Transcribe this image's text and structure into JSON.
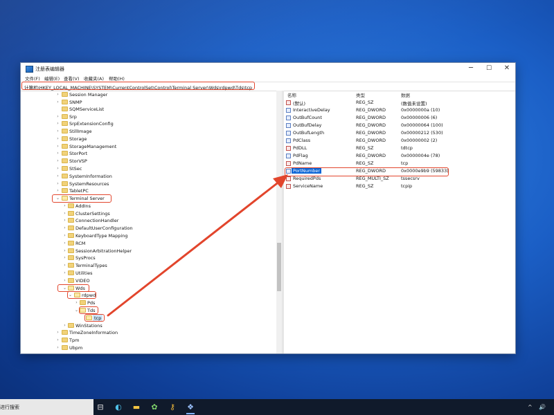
{
  "window": {
    "title": "注册表编辑器",
    "minimize_glyph": "─",
    "maximize_glyph": "☐",
    "close_glyph": "✕"
  },
  "menu": [
    "文件(F)",
    "编辑(E)",
    "查看(V)",
    "收藏夹(A)",
    "帮助(H)"
  ],
  "address": "计算机\\HKEY_LOCAL_MACHINE\\SYSTEM\\CurrentControlSet\\Control\\Terminal Server\\Wds\\rdpwd\\Tds\\tcp",
  "tree": [
    {
      "label": "Session Manager",
      "expand": "›"
    },
    {
      "label": "SNMP",
      "expand": "›"
    },
    {
      "label": "SQMServiceList",
      "expand": ""
    },
    {
      "label": "Srp",
      "expand": "›"
    },
    {
      "label": "SrpExtensionConfig",
      "expand": "›"
    },
    {
      "label": "StillImage",
      "expand": "›"
    },
    {
      "label": "Storage",
      "expand": "›"
    },
    {
      "label": "StorageManagement",
      "expand": "›"
    },
    {
      "label": "StorPort",
      "expand": "›"
    },
    {
      "label": "StorVSP",
      "expand": "›"
    },
    {
      "label": "StSec",
      "expand": "›"
    },
    {
      "label": "SystemInformation",
      "expand": "›"
    },
    {
      "label": "SystemResources",
      "expand": "›"
    },
    {
      "label": "TabletPC",
      "expand": "›"
    },
    {
      "label": "Terminal Server",
      "expand": "⌄"
    },
    {
      "label": "AddIns",
      "expand": "›"
    },
    {
      "label": "ClusterSettings",
      "expand": "›"
    },
    {
      "label": "ConnectionHandler",
      "expand": "›"
    },
    {
      "label": "DefaultUserConfiguration",
      "expand": "›"
    },
    {
      "label": "KeyboardType Mapping",
      "expand": "›"
    },
    {
      "label": "RCM",
      "expand": "›"
    },
    {
      "label": "SessionArbitrationHelper",
      "expand": "›"
    },
    {
      "label": "SysProcs",
      "expand": "›"
    },
    {
      "label": "TerminalTypes",
      "expand": "›"
    },
    {
      "label": "Utilities",
      "expand": "›"
    },
    {
      "label": "VIDEO",
      "expand": "›"
    },
    {
      "label": "Wds",
      "expand": "⌄"
    },
    {
      "label": "rdpwd",
      "expand": "⌄"
    },
    {
      "label": "Pds",
      "expand": "›"
    },
    {
      "label": "Tds",
      "expand": "⌄"
    },
    {
      "label": "tcp",
      "expand": ""
    },
    {
      "label": "WinStations",
      "expand": "›"
    },
    {
      "label": "TimeZoneInformation",
      "expand": "›"
    },
    {
      "label": "Tpm",
      "expand": "›"
    },
    {
      "label": "Ubpm",
      "expand": "›"
    }
  ],
  "list": {
    "headers": {
      "name": "名称",
      "type": "类型",
      "data": "数据"
    },
    "rows": [
      {
        "name": "(默认)",
        "type": "REG_SZ",
        "data": "(数值未设置)",
        "kind": "ab"
      },
      {
        "name": "InteractiveDelay",
        "type": "REG_DWORD",
        "data": "0x0000000a (10)",
        "kind": "bin"
      },
      {
        "name": "OutBufCount",
        "type": "REG_DWORD",
        "data": "0x00000006 (6)",
        "kind": "bin"
      },
      {
        "name": "OutBufDelay",
        "type": "REG_DWORD",
        "data": "0x00000064 (100)",
        "kind": "bin"
      },
      {
        "name": "OutBufLength",
        "type": "REG_DWORD",
        "data": "0x00000212 (530)",
        "kind": "bin"
      },
      {
        "name": "PdClass",
        "type": "REG_DWORD",
        "data": "0x00000002 (2)",
        "kind": "bin"
      },
      {
        "name": "PdDLL",
        "type": "REG_SZ",
        "data": "tdtcp",
        "kind": "ab"
      },
      {
        "name": "PdFlag",
        "type": "REG_DWORD",
        "data": "0x0000004e (78)",
        "kind": "bin"
      },
      {
        "name": "PdName",
        "type": "REG_SZ",
        "data": "tcp",
        "kind": "ab"
      },
      {
        "name": "PortNumber",
        "type": "REG_DWORD",
        "data": "0x0000e9b9 (59833)",
        "kind": "bin"
      },
      {
        "name": "RequiredPds",
        "type": "REG_MULTI_SZ",
        "data": "tssecsrv",
        "kind": "ab"
      },
      {
        "name": "ServiceName",
        "type": "REG_SZ",
        "data": "tcpip",
        "kind": "ab"
      }
    ]
  },
  "taskbar": {
    "search_text": "进行搜索",
    "icons": [
      "task-view-icon",
      "edge-icon",
      "file-explorer-icon",
      "green-app-icon",
      "key-app-icon",
      "regedit-icon"
    ],
    "tray": {
      "chevron": "^",
      "volume_glyph": "🔊"
    }
  },
  "colors": {
    "highlight": "#e2452c",
    "selection": "#0a64d6",
    "accent": "#1b5fc6"
  }
}
